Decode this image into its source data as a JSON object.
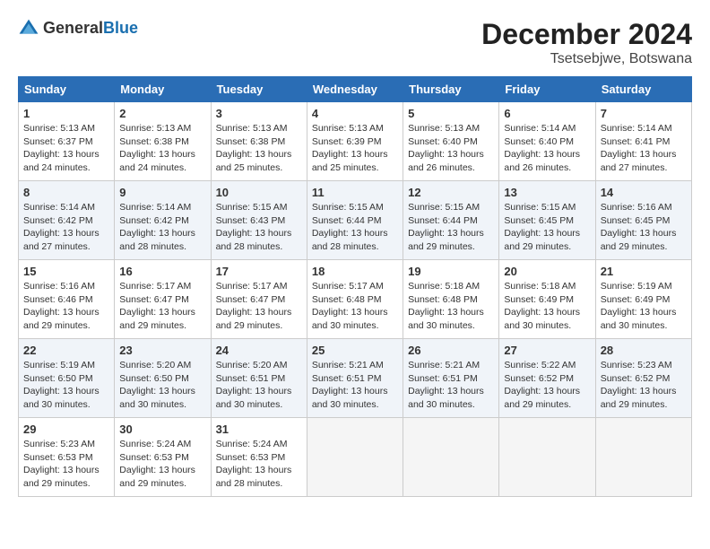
{
  "header": {
    "logo_general": "General",
    "logo_blue": "Blue",
    "title": "December 2024",
    "location": "Tsetsebjwe, Botswana"
  },
  "weekdays": [
    "Sunday",
    "Monday",
    "Tuesday",
    "Wednesday",
    "Thursday",
    "Friday",
    "Saturday"
  ],
  "weeks": [
    [
      {
        "day": 1,
        "sunrise": "5:13 AM",
        "sunset": "6:37 PM",
        "daylight": "13 hours and 24 minutes."
      },
      {
        "day": 2,
        "sunrise": "5:13 AM",
        "sunset": "6:38 PM",
        "daylight": "13 hours and 24 minutes."
      },
      {
        "day": 3,
        "sunrise": "5:13 AM",
        "sunset": "6:38 PM",
        "daylight": "13 hours and 25 minutes."
      },
      {
        "day": 4,
        "sunrise": "5:13 AM",
        "sunset": "6:39 PM",
        "daylight": "13 hours and 25 minutes."
      },
      {
        "day": 5,
        "sunrise": "5:13 AM",
        "sunset": "6:40 PM",
        "daylight": "13 hours and 26 minutes."
      },
      {
        "day": 6,
        "sunrise": "5:14 AM",
        "sunset": "6:40 PM",
        "daylight": "13 hours and 26 minutes."
      },
      {
        "day": 7,
        "sunrise": "5:14 AM",
        "sunset": "6:41 PM",
        "daylight": "13 hours and 27 minutes."
      }
    ],
    [
      {
        "day": 8,
        "sunrise": "5:14 AM",
        "sunset": "6:42 PM",
        "daylight": "13 hours and 27 minutes."
      },
      {
        "day": 9,
        "sunrise": "5:14 AM",
        "sunset": "6:42 PM",
        "daylight": "13 hours and 28 minutes."
      },
      {
        "day": 10,
        "sunrise": "5:15 AM",
        "sunset": "6:43 PM",
        "daylight": "13 hours and 28 minutes."
      },
      {
        "day": 11,
        "sunrise": "5:15 AM",
        "sunset": "6:44 PM",
        "daylight": "13 hours and 28 minutes."
      },
      {
        "day": 12,
        "sunrise": "5:15 AM",
        "sunset": "6:44 PM",
        "daylight": "13 hours and 29 minutes."
      },
      {
        "day": 13,
        "sunrise": "5:15 AM",
        "sunset": "6:45 PM",
        "daylight": "13 hours and 29 minutes."
      },
      {
        "day": 14,
        "sunrise": "5:16 AM",
        "sunset": "6:45 PM",
        "daylight": "13 hours and 29 minutes."
      }
    ],
    [
      {
        "day": 15,
        "sunrise": "5:16 AM",
        "sunset": "6:46 PM",
        "daylight": "13 hours and 29 minutes."
      },
      {
        "day": 16,
        "sunrise": "5:17 AM",
        "sunset": "6:47 PM",
        "daylight": "13 hours and 29 minutes."
      },
      {
        "day": 17,
        "sunrise": "5:17 AM",
        "sunset": "6:47 PM",
        "daylight": "13 hours and 29 minutes."
      },
      {
        "day": 18,
        "sunrise": "5:17 AM",
        "sunset": "6:48 PM",
        "daylight": "13 hours and 30 minutes."
      },
      {
        "day": 19,
        "sunrise": "5:18 AM",
        "sunset": "6:48 PM",
        "daylight": "13 hours and 30 minutes."
      },
      {
        "day": 20,
        "sunrise": "5:18 AM",
        "sunset": "6:49 PM",
        "daylight": "13 hours and 30 minutes."
      },
      {
        "day": 21,
        "sunrise": "5:19 AM",
        "sunset": "6:49 PM",
        "daylight": "13 hours and 30 minutes."
      }
    ],
    [
      {
        "day": 22,
        "sunrise": "5:19 AM",
        "sunset": "6:50 PM",
        "daylight": "13 hours and 30 minutes."
      },
      {
        "day": 23,
        "sunrise": "5:20 AM",
        "sunset": "6:50 PM",
        "daylight": "13 hours and 30 minutes."
      },
      {
        "day": 24,
        "sunrise": "5:20 AM",
        "sunset": "6:51 PM",
        "daylight": "13 hours and 30 minutes."
      },
      {
        "day": 25,
        "sunrise": "5:21 AM",
        "sunset": "6:51 PM",
        "daylight": "13 hours and 30 minutes."
      },
      {
        "day": 26,
        "sunrise": "5:21 AM",
        "sunset": "6:51 PM",
        "daylight": "13 hours and 30 minutes."
      },
      {
        "day": 27,
        "sunrise": "5:22 AM",
        "sunset": "6:52 PM",
        "daylight": "13 hours and 29 minutes."
      },
      {
        "day": 28,
        "sunrise": "5:23 AM",
        "sunset": "6:52 PM",
        "daylight": "13 hours and 29 minutes."
      }
    ],
    [
      {
        "day": 29,
        "sunrise": "5:23 AM",
        "sunset": "6:53 PM",
        "daylight": "13 hours and 29 minutes."
      },
      {
        "day": 30,
        "sunrise": "5:24 AM",
        "sunset": "6:53 PM",
        "daylight": "13 hours and 29 minutes."
      },
      {
        "day": 31,
        "sunrise": "5:24 AM",
        "sunset": "6:53 PM",
        "daylight": "13 hours and 28 minutes."
      },
      null,
      null,
      null,
      null
    ]
  ]
}
